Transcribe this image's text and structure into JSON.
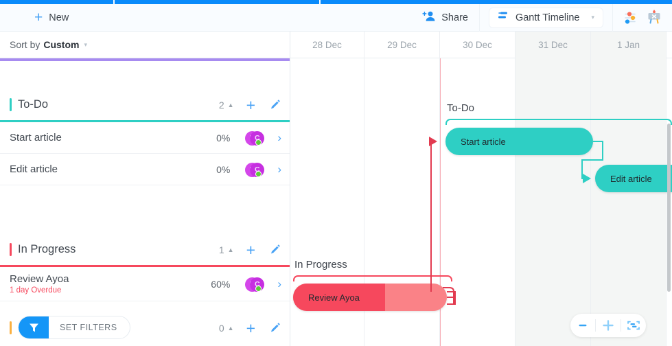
{
  "toolbar": {
    "new_label": "New",
    "new_icon": "plus-icon",
    "share_label": "Share",
    "share_icon": "add-person-icon",
    "view_label": "Gantt Timeline",
    "view_icon": "gantt-icon",
    "view_caret": "▾",
    "settings_icon": "sliders-icon",
    "whiteboard_icon": "whiteboard-tools-icon"
  },
  "sidebar": {
    "sort": {
      "prefix": "Sort by",
      "value": "Custom",
      "caret": "▾"
    },
    "accent_color": "#a78bf0",
    "groups": [
      {
        "name": "To-Do",
        "count": "2",
        "color": "#2ecfc4",
        "collapse_icon": "chevron-up-icon",
        "add_icon": "plus-icon",
        "edit_icon": "pencil-icon",
        "tasks": [
          {
            "name": "Start article",
            "sub": "",
            "percent": "0%",
            "avatar": [
              "M",
              "C"
            ],
            "chevron": "›"
          },
          {
            "name": "Edit article",
            "sub": "",
            "percent": "0%",
            "avatar": [
              "M",
              "C"
            ],
            "chevron": "›"
          }
        ]
      },
      {
        "name": "In Progress",
        "count": "1",
        "color": "#f6485d",
        "collapse_icon": "chevron-up-icon",
        "add_icon": "plus-icon",
        "edit_icon": "pencil-icon",
        "tasks": [
          {
            "name": "Review Ayoa",
            "sub": "1 day Overdue",
            "percent": "60%",
            "avatar": [
              "M",
              "C"
            ],
            "chevron": "›"
          }
        ]
      }
    ],
    "bottom_group": {
      "count": "0",
      "color": "#fbb040",
      "collapse_icon": "chevron-up-icon",
      "add_icon": "plus-icon",
      "edit_icon": "pencil-icon"
    },
    "filter_button": {
      "label": "SET FILTERS",
      "icon": "funnel-icon",
      "badge_color": "#1596f7"
    }
  },
  "gantt": {
    "columns": [
      {
        "label": "28 Dec",
        "weekend": false
      },
      {
        "label": "29 Dec",
        "weekend": false
      },
      {
        "label": "30 Dec",
        "weekend": false
      },
      {
        "label": "31 Dec",
        "weekend": true
      },
      {
        "label": "1 Jan",
        "weekend": true
      }
    ],
    "today_marker_color": "#f6a9b3",
    "group_labels": [
      {
        "text": "To-Do",
        "color": "#2ecfc4"
      },
      {
        "text": "In Progress",
        "color": "#f6485d"
      }
    ],
    "bars": [
      {
        "label": "Start article",
        "color": "#2ecfc4",
        "progress": "0%"
      },
      {
        "label": "Edit article",
        "color": "#2ecfc4",
        "progress": "0%"
      },
      {
        "label": "Review Ayoa",
        "color": "#fa8287",
        "progress": "60%",
        "progress_color": "#f6485d"
      }
    ],
    "zoom_controls": {
      "zoom_out_icon": "minus-icon",
      "zoom_in_icon": "plus-icon",
      "fit_icon": "fit-to-screen-icon"
    }
  }
}
